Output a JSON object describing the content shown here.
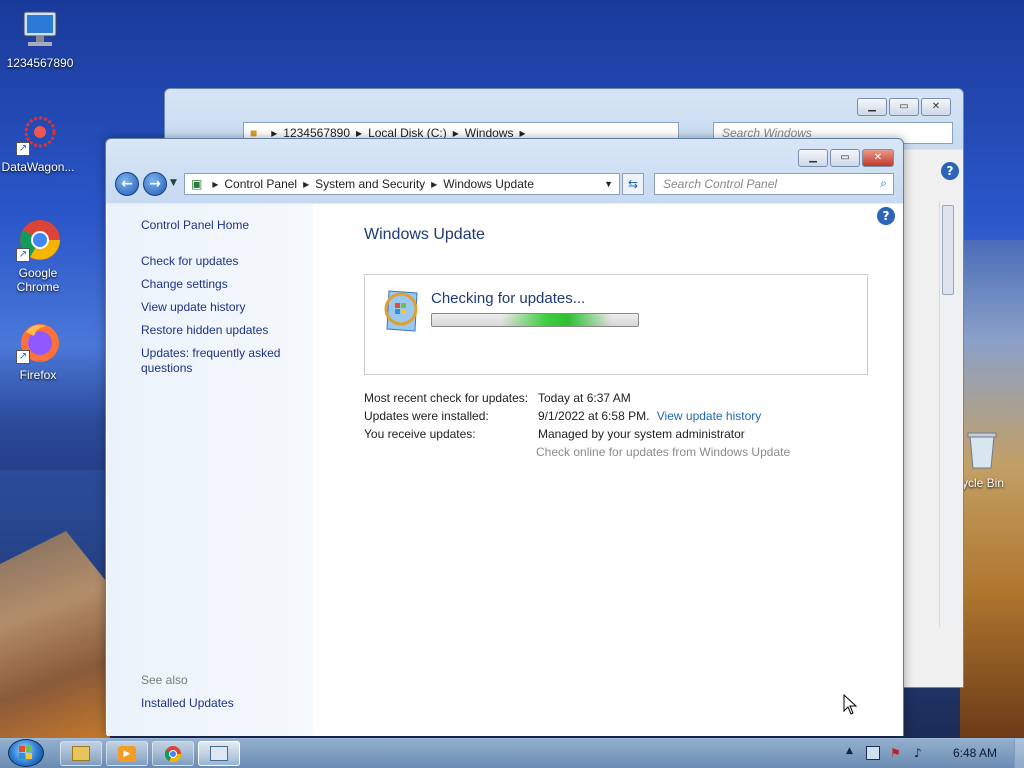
{
  "desktop": {
    "icons": [
      {
        "label": "1234567890",
        "icon": "computer-icon"
      },
      {
        "label": "DataWagon...",
        "icon": "datawagon-icon"
      },
      {
        "label": "Google Chrome",
        "icon": "chrome-icon"
      },
      {
        "label": "Firefox",
        "icon": "firefox-icon"
      },
      {
        "label": "ycle Bin",
        "icon": "recycle-bin-icon"
      }
    ]
  },
  "background_window": {
    "breadcrumb": [
      "1234567890",
      "Local Disk (C:)",
      "Windows"
    ],
    "search_placeholder": "Search Windows"
  },
  "main_window": {
    "breadcrumb": [
      "Control Panel",
      "System and Security",
      "Windows Update"
    ],
    "search_placeholder": "Search Control Panel",
    "sidebar": {
      "home": "Control Panel Home",
      "links": [
        "Check for updates",
        "Change settings",
        "View update history",
        "Restore hidden updates",
        "Updates: frequently asked questions"
      ],
      "see_also_heading": "See also",
      "see_also_links": [
        "Installed Updates"
      ]
    },
    "title": "Windows Update",
    "status": {
      "text": "Checking for updates...",
      "progress_state": "indeterminate"
    },
    "info": {
      "recent_check_label": "Most recent check for updates:",
      "recent_check_value": "Today at 6:37 AM",
      "installed_label": "Updates were installed:",
      "installed_value": "9/1/2022 at 6:58 PM.",
      "installed_link": "View update history",
      "receive_label": "You receive updates:",
      "receive_value": "Managed by your system administrator",
      "online_link": "Check online for updates from Windows Update"
    }
  },
  "taskbar": {
    "items": [
      "explorer-icon",
      "media-player-icon",
      "chrome-icon",
      "control-panel-icon"
    ],
    "active_item": "control-panel-icon",
    "clock": "6:48 AM"
  },
  "colors": {
    "accent_link": "#1f66c2",
    "title_blue": "#1e3a78",
    "progress_green": "#3fce3f"
  }
}
